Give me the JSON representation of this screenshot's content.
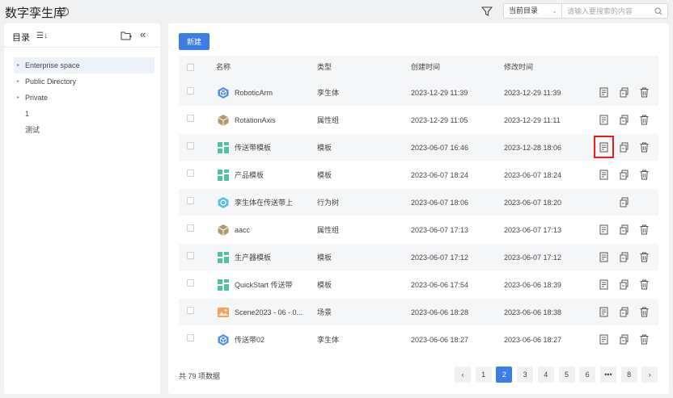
{
  "header": {
    "title": "数字孪生库",
    "scope_value": "当前目录",
    "search_placeholder": "请输入要搜索的内容"
  },
  "sidebar": {
    "title": "目录",
    "items": [
      {
        "label": "Enterprise space",
        "has_children": true,
        "selected": true
      },
      {
        "label": "Public Directory",
        "has_children": true,
        "selected": false
      },
      {
        "label": "Private",
        "has_children": true,
        "selected": false
      },
      {
        "label": "1",
        "has_children": false,
        "selected": false
      },
      {
        "label": "测试",
        "has_children": false,
        "selected": false
      }
    ]
  },
  "toolbar": {
    "new_label": "新建"
  },
  "table": {
    "headers": {
      "name": "名称",
      "type": "类型",
      "created": "创建时间",
      "modified": "修改时间"
    },
    "rows": [
      {
        "name": "RoboticArm",
        "type": "孪生体",
        "created": "2023-12-29 11:39",
        "modified": "2023-12-29 11:39",
        "icon": "twin-cube-icon",
        "actions": [
          "doc",
          "copy",
          "delete"
        ]
      },
      {
        "name": "RotationAxis",
        "type": "属性组",
        "created": "2023-12-29 11:05",
        "modified": "2023-12-29 11:11",
        "icon": "property-group-icon",
        "actions": [
          "doc",
          "copy",
          "delete"
        ]
      },
      {
        "name": "传送带模板",
        "type": "模板",
        "created": "2023-06-07 16:46",
        "modified": "2023-12-28 18:06",
        "icon": "template-icon",
        "actions": [
          "doc",
          "copy",
          "delete"
        ],
        "highlight": true
      },
      {
        "name": "产品模板",
        "type": "模板",
        "created": "2023-06-07 18:24",
        "modified": "2023-06-07 18:24",
        "icon": "template-icon",
        "actions": [
          "doc",
          "copy",
          "delete"
        ]
      },
      {
        "name": "孪生体在传送带上",
        "type": "行为树",
        "created": "2023-06-07 18:06",
        "modified": "2023-06-07 18:20",
        "icon": "behavior-tree-icon",
        "actions": [
          "copy"
        ]
      },
      {
        "name": "aacc",
        "type": "属性组",
        "created": "2023-06-07 17:13",
        "modified": "2023-06-07 17:13",
        "icon": "property-group-icon",
        "actions": [
          "doc",
          "copy",
          "delete"
        ]
      },
      {
        "name": "生产器模板",
        "type": "模板",
        "created": "2023-06-07 17:12",
        "modified": "2023-06-07 17:12",
        "icon": "template-icon",
        "actions": [
          "doc",
          "copy",
          "delete"
        ]
      },
      {
        "name": "QuickStart 传送带",
        "type": "模板",
        "created": "2023-06-06 17:54",
        "modified": "2023-06-06 18:39",
        "icon": "template-icon",
        "actions": [
          "doc",
          "copy",
          "delete"
        ]
      },
      {
        "name": "Scene2023 - 06 - 0...",
        "type": "场景",
        "created": "2023-06-06 18:28",
        "modified": "2023-06-06 18:38",
        "icon": "scene-image-icon",
        "actions": [
          "doc",
          "copy",
          "delete"
        ]
      },
      {
        "name": "传送带02",
        "type": "孪生体",
        "created": "2023-06-06 18:27",
        "modified": "2023-06-06 18:27",
        "icon": "twin-cube-icon",
        "actions": [
          "doc",
          "copy",
          "delete"
        ]
      }
    ]
  },
  "footer": {
    "total_text": "共 79 项数据",
    "pages": [
      "1",
      "2",
      "3",
      "4",
      "5",
      "6",
      "•••",
      "8"
    ],
    "current_page": "2",
    "prev_symbol": "‹",
    "next_symbol": "›"
  },
  "colors": {
    "accent": "#3a7ee6",
    "highlight": "#e02020",
    "twin": "#4a90e2",
    "property": "#b39a6e",
    "template": "#4fc4a5",
    "scene": "#f5a25d"
  }
}
